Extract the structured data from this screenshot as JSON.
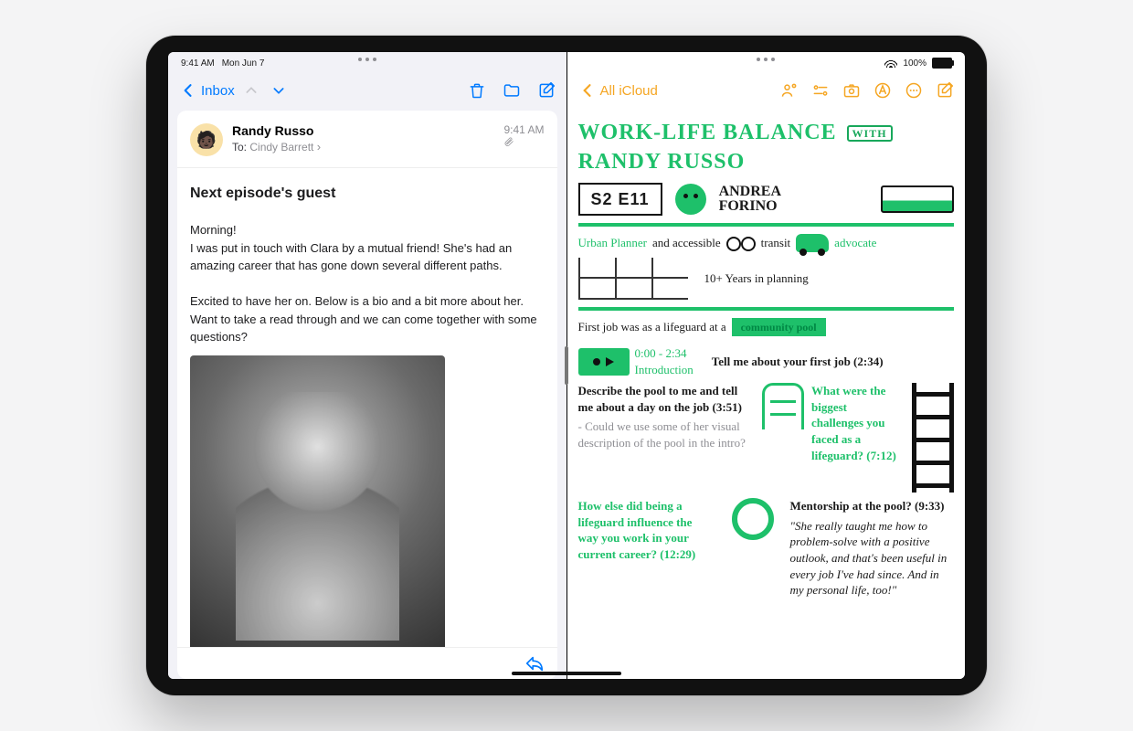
{
  "status": {
    "time": "9:41 AM",
    "date": "Mon Jun 7",
    "battery": "100%"
  },
  "mail": {
    "back": "Inbox",
    "from": "Randy Russo",
    "to_label": "To:",
    "to_value": "Cindy Barrett",
    "time": "9:41 AM",
    "subject": "Next episode's guest",
    "p1": "Morning!",
    "p2": "I was put in touch with Clara by a mutual friend! She's had an amazing career that has gone down several different paths.",
    "p3": "Excited to have her on. Below is a bio and a bit more about her. Want to take a read through and we can come together with some questions?"
  },
  "notes": {
    "back": "All iCloud",
    "title_a": "WORK-LIFE BALANCE",
    "title_with": "WITH",
    "title_b": "RANDY RUSSO",
    "tag": "S2 E11",
    "andrea1": "ANDREA",
    "andrea2": "FORINO",
    "line_urban_a": "Urban Planner",
    "line_urban_b": "and accessible",
    "line_urban_c": "transit",
    "line_urban_d": "advocate",
    "years": "10+ Years in planning",
    "firstjob_a": "First job was as a lifeguard at a",
    "firstjob_b": "community pool",
    "clip_time": "0:00 - 2:34",
    "clip_label": "Introduction",
    "q1": "Tell me about your first job (2:34)",
    "q2": "Describe the pool to me and tell me about a day on the job (3:51)",
    "q2_sub": "- Could we use some of her visual description of the pool in the intro?",
    "q3": "What were the biggest challenges you faced as a lifeguard? (7:12)",
    "q4": "How else did being a lifeguard influence the way you work in your current career? (12:29)",
    "q5": "Mentorship at the pool? (9:33)",
    "quote": "\"She really taught me how to problem-solve with a positive outlook, and that's been useful in every job I've had since. And in my personal life, too!\""
  }
}
